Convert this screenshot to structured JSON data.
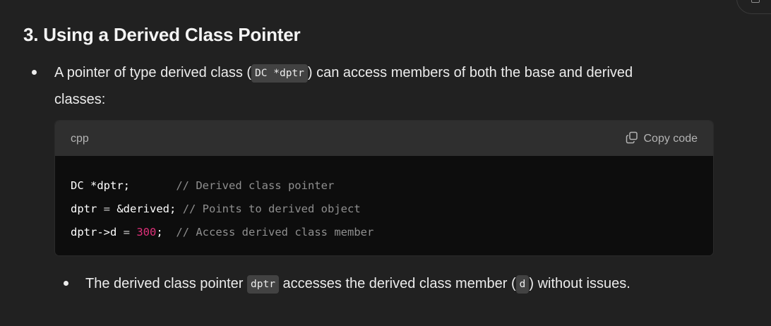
{
  "section": {
    "heading": "3. Using a Derived Class Pointer"
  },
  "bullet1": {
    "text_before": "A pointer of type derived class (",
    "code": "DC *dptr",
    "text_after": ") can access members of both the base and derived",
    "text_line2": "classes:"
  },
  "code_block": {
    "language": "cpp",
    "copy_label": "Copy code",
    "lines": [
      {
        "code": "DC *dptr;",
        "pad": "       ",
        "comment": "// Derived class pointer"
      },
      {
        "code_a": "dptr ",
        "op": "=",
        "code_b": " &derived;",
        "pad": " ",
        "comment": "// Points to derived object"
      },
      {
        "code_a": "dptr->d ",
        "op": "=",
        "pad_a": " ",
        "number": "300",
        "code_b": ";",
        "pad": "  ",
        "comment": "// Access derived class member"
      }
    ]
  },
  "bullet2": {
    "text_before": "The derived class pointer ",
    "code1": "dptr",
    "text_mid": " accesses the derived class member (",
    "code2": "d",
    "text_after": ") without issues."
  },
  "icons": {
    "copy": "copy-icon",
    "bullet": "bullet-dot-icon",
    "corner": "window-icon"
  }
}
